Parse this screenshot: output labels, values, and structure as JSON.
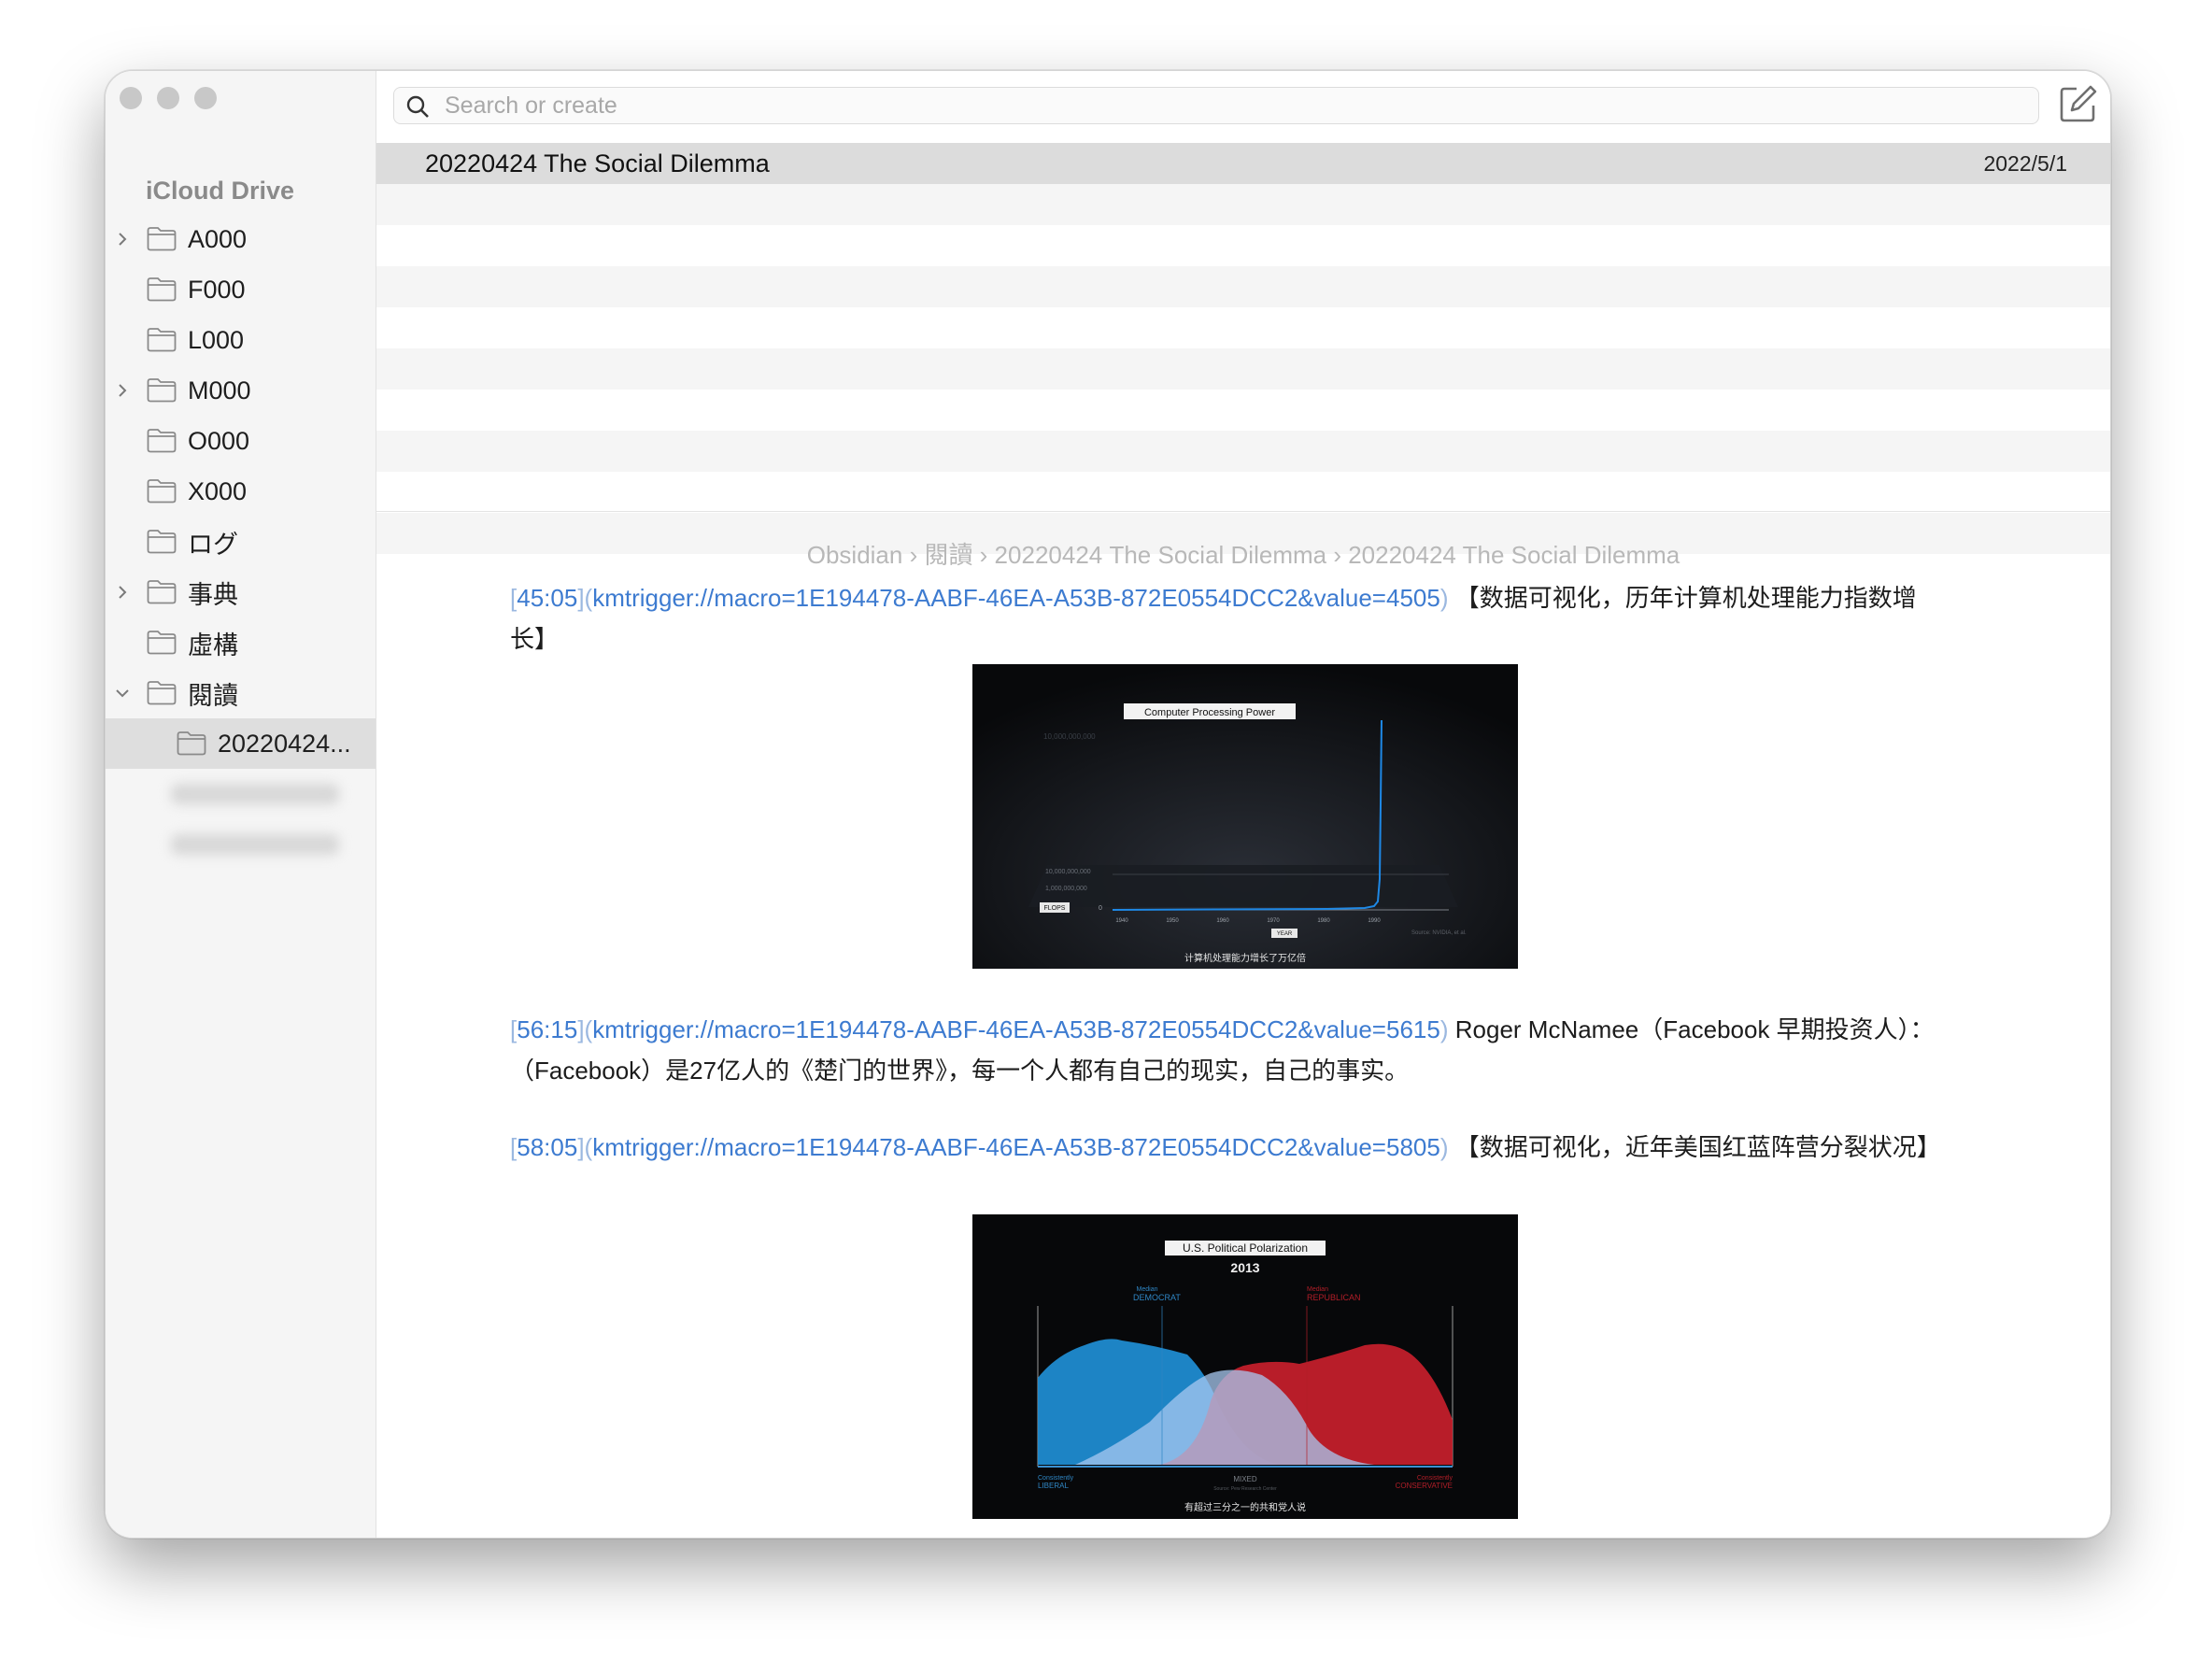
{
  "sidebar": {
    "heading": "iCloud Drive",
    "items": [
      {
        "label": "A000",
        "expandable": true
      },
      {
        "label": "F000",
        "expandable": false
      },
      {
        "label": "L000",
        "expandable": false
      },
      {
        "label": "M000",
        "expandable": true
      },
      {
        "label": "O000",
        "expandable": false
      },
      {
        "label": "X000",
        "expandable": false
      },
      {
        "label": "ログ",
        "expandable": false
      },
      {
        "label": "事典",
        "expandable": true
      },
      {
        "label": "虛構",
        "expandable": false
      },
      {
        "label": "閱讀",
        "expandable": true,
        "expanded": true
      }
    ],
    "child": {
      "label": "20220424...",
      "selected": true
    }
  },
  "search": {
    "placeholder": "Search or create"
  },
  "notes": [
    {
      "title": "20220424 The Social Dilemma",
      "date": "2022/5/1"
    }
  ],
  "breadcrumb": "Obsidian › 閱讀 › 20220424 The Social Dilemma › 20220424 The Social Dilemma",
  "entries": [
    {
      "time": "45:05",
      "url": "kmtrigger://macro=1E194478-AABF-46EA-A53B-872E0554DCC2&value=4505",
      "text": "【数据可视化，历年计算机处理能力指数增长】"
    },
    {
      "time": "56:15",
      "url": "kmtrigger://macro=1E194478-AABF-46EA-A53B-872E0554DCC2&value=5615",
      "text": "Roger McNamee（Facebook 早期投资人）：",
      "text2": "（Facebook）是27亿人的《楚门的世界》，每一个人都有自己的现实，自己的事实。"
    },
    {
      "time": "58:05",
      "url": "kmtrigger://macro=1E194478-AABF-46EA-A53B-872E0554DCC2&value=5805",
      "text": "【数据可视化，近年美国红蓝阵营分裂状况】"
    }
  ],
  "screenshot1": {
    "title": "Computer Processing Power",
    "top_label": "10,000,000,000",
    "mid_label": "10,000,000,000",
    "mid_label2": "1,000,000,000",
    "ylabel": "FLOPS",
    "zero": "0",
    "years": [
      "1940",
      "1950",
      "1960",
      "1970",
      "1980",
      "1990"
    ],
    "xlabel": "YEAR",
    "source": "Source: NVIDIA, et al.",
    "subtitle": "计算机处理能力增长了万亿倍",
    "color": "#1e88e5"
  },
  "screenshot2": {
    "title": "U.S. Political Polarization",
    "year": "2013",
    "dem_small": "Median",
    "dem_label": "DEMOCRAT",
    "rep_small": "Median",
    "rep_label": "REPUBLICAN",
    "left_small": "Consistently",
    "left_label": "LIBERAL",
    "mid_label": "MIXED",
    "mid_source": "Source: Pew Research Center",
    "right_small": "Consistently",
    "right_label": "CONSERVATIVE",
    "subtitle": "有超过三分之一的共和党人说",
    "dem_color": "#1f8fd6",
    "rep_color": "#c8202c"
  }
}
